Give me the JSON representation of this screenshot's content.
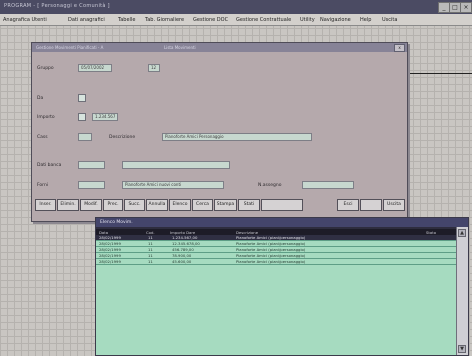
{
  "window": {
    "title": "PROGRAM - [ Personaggi e Comunità ]",
    "min": "_",
    "max": "□",
    "close": "×"
  },
  "menu": [
    "Anagrafica Utenti",
    "Dati anagrafici",
    "Tabelle",
    "Tab. Giornaliere",
    "Gestione DOC",
    "Gestione Contrattuale",
    "Utility",
    "Navigazione",
    "Help",
    "Uscita"
  ],
  "form": {
    "title": "Gestione Movimenti Pianificati - A",
    "subtitle": "Lista Movimenti",
    "close": "x",
    "labels": {
      "gruppo": "Gruppo",
      "da": "Da",
      "importo": "Importo",
      "cass": "Cass",
      "descrizione": "Descrizione",
      "dati_banca": "Dati banca",
      "forni": "Forni",
      "n_assegno": "N.assegno"
    },
    "values": {
      "gruppo": "05/07/2002",
      "gruppo2": "12",
      "importo": "1.234.567",
      "descrizione": "Pianoforte Amici Personaggio",
      "forni": "Pianoforte Amici nuovi conti"
    },
    "buttons": [
      "Inser.",
      "Elimin.",
      "Modif.",
      "Prec.",
      "Succ.",
      "Annulla",
      "Elenco",
      "Cerca",
      "Stampa",
      "Stati",
      "",
      "Esci",
      "",
      "Uscita"
    ]
  },
  "list": {
    "title": "Elenco Movim.",
    "headers": [
      "Data",
      "Cod.",
      "Importo Dare",
      "Descrizione",
      "Stato"
    ],
    "rows": [
      [
        "28/02/1999",
        "11",
        "1.234.567,00",
        "Pianoforte Amici (piani/personaggio)"
      ],
      [
        "28/02/1999",
        "11",
        "12.345.678,00",
        "Pianoforte Amici (piani/personaggio)"
      ],
      [
        "28/02/1999",
        "11",
        "456.789,00",
        "Pianoforte Amici (piani/personaggio)"
      ],
      [
        "28/02/1999",
        "11",
        "78.900,00",
        "Pianoforte Amici (piani/personaggio)"
      ],
      [
        "28/02/1999",
        "11",
        "45.600,00",
        "Pianoforte Amici (piani/personaggio)"
      ]
    ],
    "scroll_up": "▲",
    "scroll_down": "▼"
  }
}
